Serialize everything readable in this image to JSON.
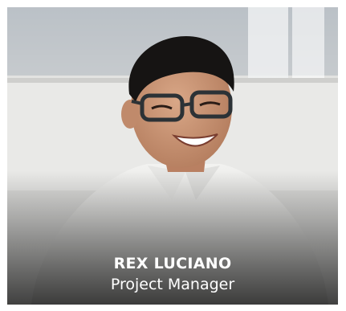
{
  "profile_card": {
    "name": "REX LUCIANO",
    "role": "Project Manager",
    "photo_icon": "person-photo"
  }
}
